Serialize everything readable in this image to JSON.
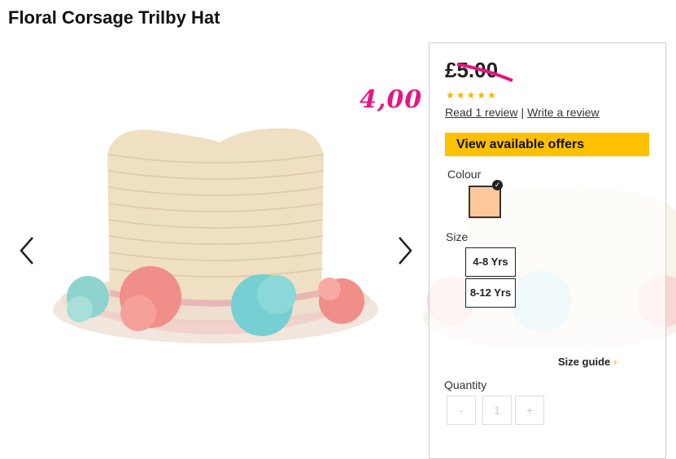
{
  "product": {
    "title": "Floral Corsage Trilby Hat",
    "old_price": "£5.00",
    "sale_price": "4,00",
    "rating_stars": "★★★★★",
    "read_reviews": "Read 1 review",
    "review_separator": "|",
    "write_review": "Write a review"
  },
  "offers_label": "View available offers",
  "colour": {
    "label": "Colour",
    "selected_swatch": "#ffc79a"
  },
  "size": {
    "label": "Size",
    "options": [
      "4-8 Yrs",
      "8-12 Yrs"
    ]
  },
  "size_guide": {
    "label": "Size guide",
    "chevron": "›"
  },
  "quantity": {
    "label": "Quantity",
    "minus": "-",
    "value": "1",
    "plus": "+"
  },
  "icons": [
    "chevron-left-icon",
    "chevron-right-icon",
    "checkmark-icon",
    "star-icon"
  ],
  "colors": {
    "offers_bg": "#ffc000",
    "sale_price": "#e6157f",
    "stars": "#f5b400",
    "strike": "#e6157f"
  }
}
